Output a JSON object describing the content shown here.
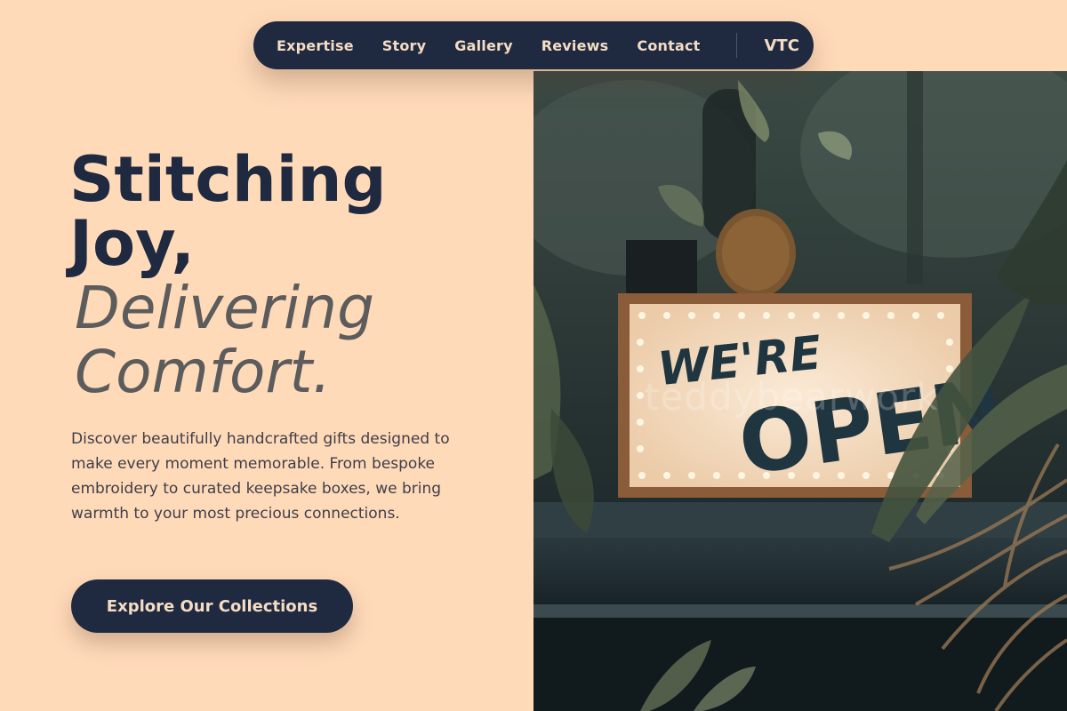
{
  "nav": {
    "links": [
      "Expertise",
      "Story",
      "Gallery",
      "Reviews",
      "Contact"
    ],
    "brand": "VTC"
  },
  "hero": {
    "title_line1": "Stitching",
    "title_line2": "Joy,",
    "subtitle_line1": "Delivering",
    "subtitle_line2": "Comfort.",
    "description": "Discover beautifully handcrafted gifts designed to make every moment memorable. From bespoke embroidery to curated keepsake boxes, we bring warmth to your most precious connections.",
    "cta_label": "Explore Our Collections"
  },
  "photo": {
    "sign_line1": "WE'RE",
    "sign_line2": "OPEN",
    "watermark": "teddybearwork"
  },
  "colors": {
    "background": "#FFDAB9",
    "navy": "#1F2A40",
    "nav_text": "#F5DCC4",
    "subtitle": "#5C5C5C"
  }
}
